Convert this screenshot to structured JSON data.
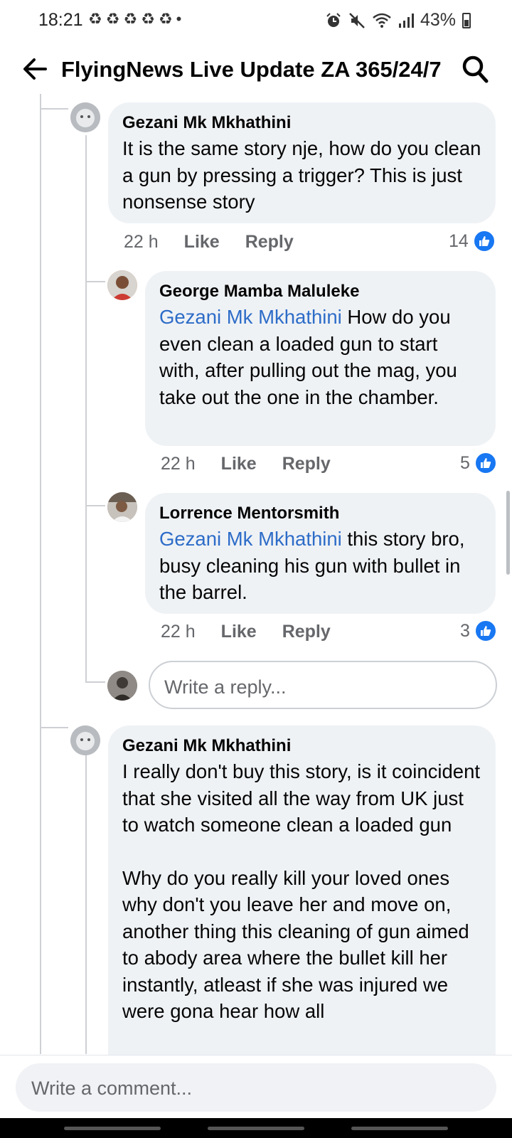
{
  "status_bar": {
    "time": "18:21",
    "notification_icons": [
      "recycle-icon",
      "recycle-icon",
      "recycle-icon",
      "recycle-icon",
      "recycle-icon"
    ],
    "dot": "•",
    "battery": "43%"
  },
  "header": {
    "title": "FlyingNews Live Update ZA 365/24/7"
  },
  "comments": [
    {
      "author": "Gezani Mk Mkhathini",
      "mention": "",
      "text": "It is the same story nje, how do you clean a gun by pressing a trigger? This is just nonsense story",
      "time": "22 h",
      "like": "Like",
      "reply": "Reply",
      "reactions": "14"
    },
    {
      "author": "George Mamba Maluleke",
      "mention": "Gezani Mk Mkhathini",
      "text": " How do you even clean a loaded gun to start with, after pulling out the mag, you take out the one in the chamber.",
      "time": "22 h",
      "like": "Like",
      "reply": "Reply",
      "reactions": "5"
    },
    {
      "author": "Lorrence Mentorsmith",
      "mention": "Gezani Mk Mkhathini",
      "text": " this story bro, busy cleaning his gun with bullet in the barrel.",
      "time": "22 h",
      "like": "Like",
      "reply": "Reply",
      "reactions": "3"
    },
    {
      "author": "Gezani Mk Mkhathini",
      "mention": "",
      "text": "I really don't buy this story, is it coincident that she visited all the way from UK just to watch someone clean a loaded gun",
      "text2": "Why do you really kill your loved ones why don't you leave her and move on, another thing this cleaning of gun aimed to abody area where the bullet kill her instantly, atleast if she was injured we were gona hear how all"
    }
  ],
  "reply_box": {
    "placeholder": "Write a reply..."
  },
  "composer": {
    "placeholder": "Write a comment..."
  },
  "colors": {
    "bubble": "#eff2f5",
    "mention": "#2d6cc8",
    "like_blue": "#1877f2",
    "meta_gray": "#65676b"
  }
}
